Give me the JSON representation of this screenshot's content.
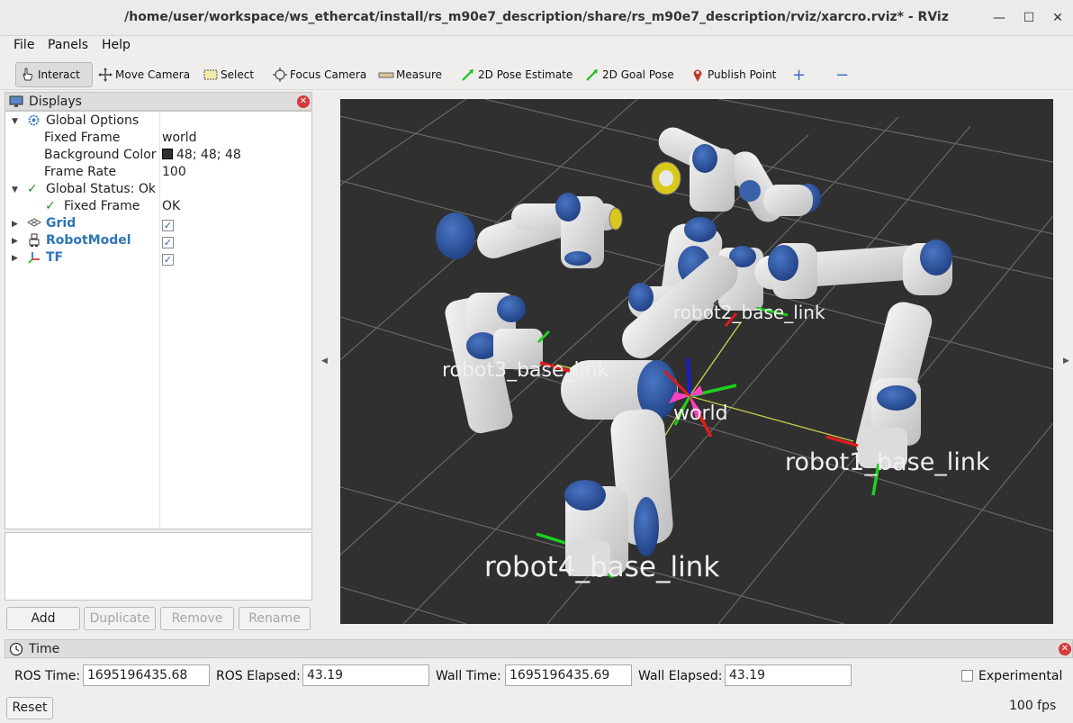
{
  "window": {
    "title": "/home/user/workspace/ws_ethercat/install/rs_m90e7_description/share/rs_m90e7_description/rviz/xarcro.rviz* - RViz",
    "minimize": "—",
    "maximize": "☐",
    "close": "✕"
  },
  "menu": [
    "File",
    "Panels",
    "Help"
  ],
  "toolbar": {
    "interact": "Interact",
    "move_camera": "Move Camera",
    "select": "Select",
    "focus_camera": "Focus Camera",
    "measure": "Measure",
    "pose_estimate": "2D Pose Estimate",
    "goal_pose": "2D Goal Pose",
    "publish_point": "Publish Point",
    "add_tool": "+",
    "remove_tool": "−"
  },
  "displays": {
    "title": "Displays",
    "global_options": {
      "label": "Global Options",
      "fixed_frame_key": "Fixed Frame",
      "fixed_frame_val": "world",
      "bg_key": "Background Color",
      "bg_val": "48; 48; 48",
      "bg_swatch": "#303030",
      "rate_key": "Frame Rate",
      "rate_val": "100"
    },
    "global_status": {
      "label": "Global Status: Ok",
      "fixed_frame_key": "Fixed Frame",
      "fixed_frame_val": "OK"
    },
    "items": [
      {
        "label": "Grid",
        "icon": "grid-icon",
        "checked": true
      },
      {
        "label": "RobotModel",
        "icon": "robot-icon",
        "checked": true
      },
      {
        "label": "TF",
        "icon": "tf-axes-icon",
        "checked": true
      }
    ],
    "buttons": {
      "add": "Add",
      "duplicate": "Duplicate",
      "remove": "Remove",
      "rename": "Rename"
    }
  },
  "viewport": {
    "labels": {
      "robot1": "robot1_base_link",
      "robot2": "robot2_base_link",
      "robot3": "robot3_base_link",
      "robot4": "robot4_base_link",
      "world": "world"
    },
    "colors": {
      "background": "#303030",
      "grid": "#6e6e6e",
      "link_white": "#e4e4e4",
      "joint_blue": "#2f58a6",
      "x_axis": "#e01b1b",
      "y_axis": "#1dd01d",
      "z_axis": "#1a1ae0",
      "tf_line": "#c8c850",
      "tf_marker": "#ff40c0"
    }
  },
  "time": {
    "title": "Time",
    "ros_time_label": "ROS Time:",
    "ros_time": "1695196435.68",
    "ros_elapsed_label": "ROS Elapsed:",
    "ros_elapsed": "43.19",
    "wall_time_label": "Wall Time:",
    "wall_time": "1695196435.69",
    "wall_elapsed_label": "Wall Elapsed:",
    "wall_elapsed": "43.19",
    "experimental": "Experimental",
    "reset": "Reset",
    "fps": "100 fps"
  }
}
